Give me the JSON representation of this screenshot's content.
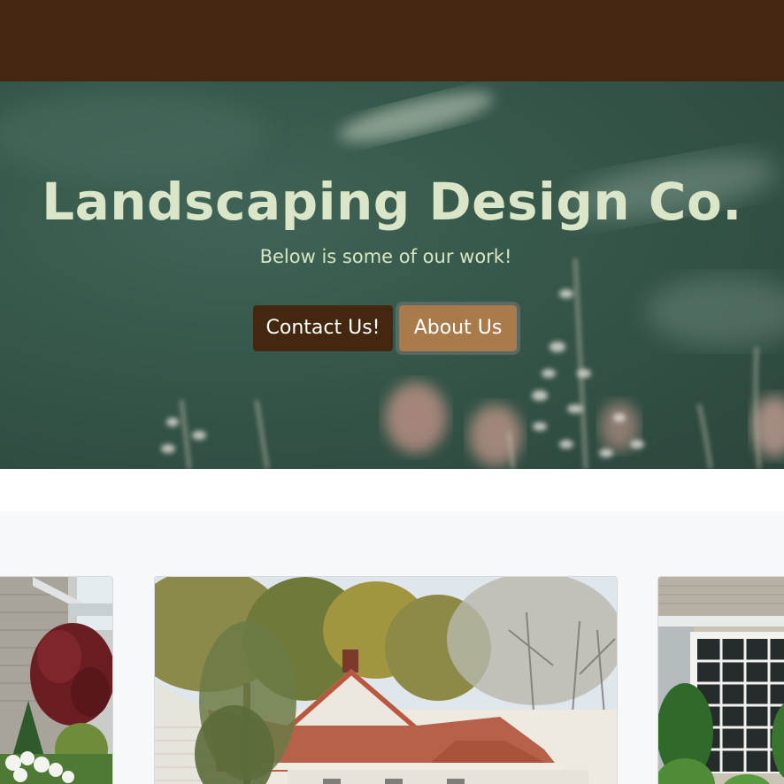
{
  "header": {
    "bar_color": "#43270f"
  },
  "hero": {
    "title": "Landscaping Design Co.",
    "subtitle": "Below is some of our work!",
    "contact_label": "Contact Us!",
    "about_label": "About Us",
    "colors": {
      "title": "#dbe6c8",
      "contact_button": "#43270f",
      "about_button": "#a97b4b"
    }
  },
  "gallery": {
    "background": "#f7f8fa",
    "cards": [
      {
        "name": "garden-photo-brick-house"
      },
      {
        "name": "garden-photo-white-house"
      },
      {
        "name": "garden-photo-window-house"
      }
    ]
  }
}
